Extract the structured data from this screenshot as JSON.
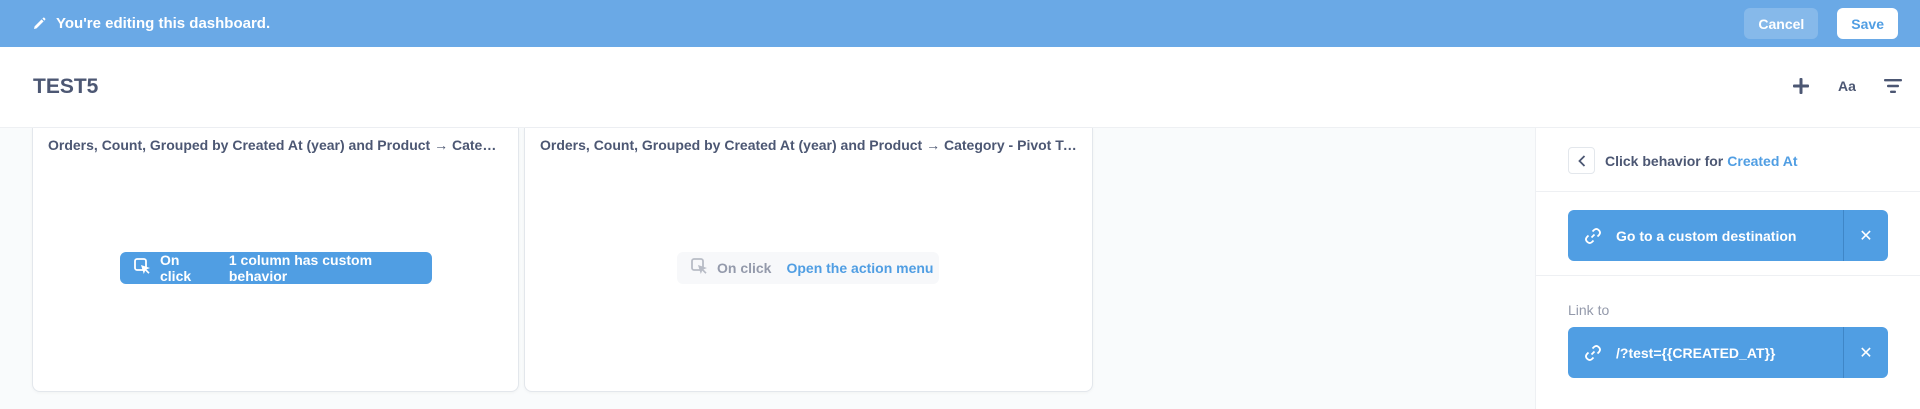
{
  "edit_bar": {
    "message": "You're editing this dashboard.",
    "cancel_label": "Cancel",
    "save_label": "Save"
  },
  "header": {
    "title": "TEST5",
    "add_icon": "plus-icon",
    "text_tool_label": "Aa",
    "filter_icon": "filter-icon"
  },
  "cards": [
    {
      "title": "Orders, Count, Grouped by Created At (year) and Product → Category - Pivot Table",
      "on_click_label": "On click",
      "on_click_value": "1 column has custom behavior"
    },
    {
      "title": "Orders, Count, Grouped by Created At (year) and Product → Category - Pivot Table",
      "on_click_label": "On click",
      "on_click_value": "Open the action menu"
    }
  ],
  "sidebar": {
    "heading_prefix": "Click behavior for",
    "column_name": "Created At",
    "destination_label": "Go to a custom destination",
    "link_to_label": "Link to",
    "link_value": "/?test={{CREATED_AT}}"
  },
  "colors": {
    "brand": "#509ee3",
    "edit_bar": "#6aa9e6",
    "text": "#4c5773"
  }
}
